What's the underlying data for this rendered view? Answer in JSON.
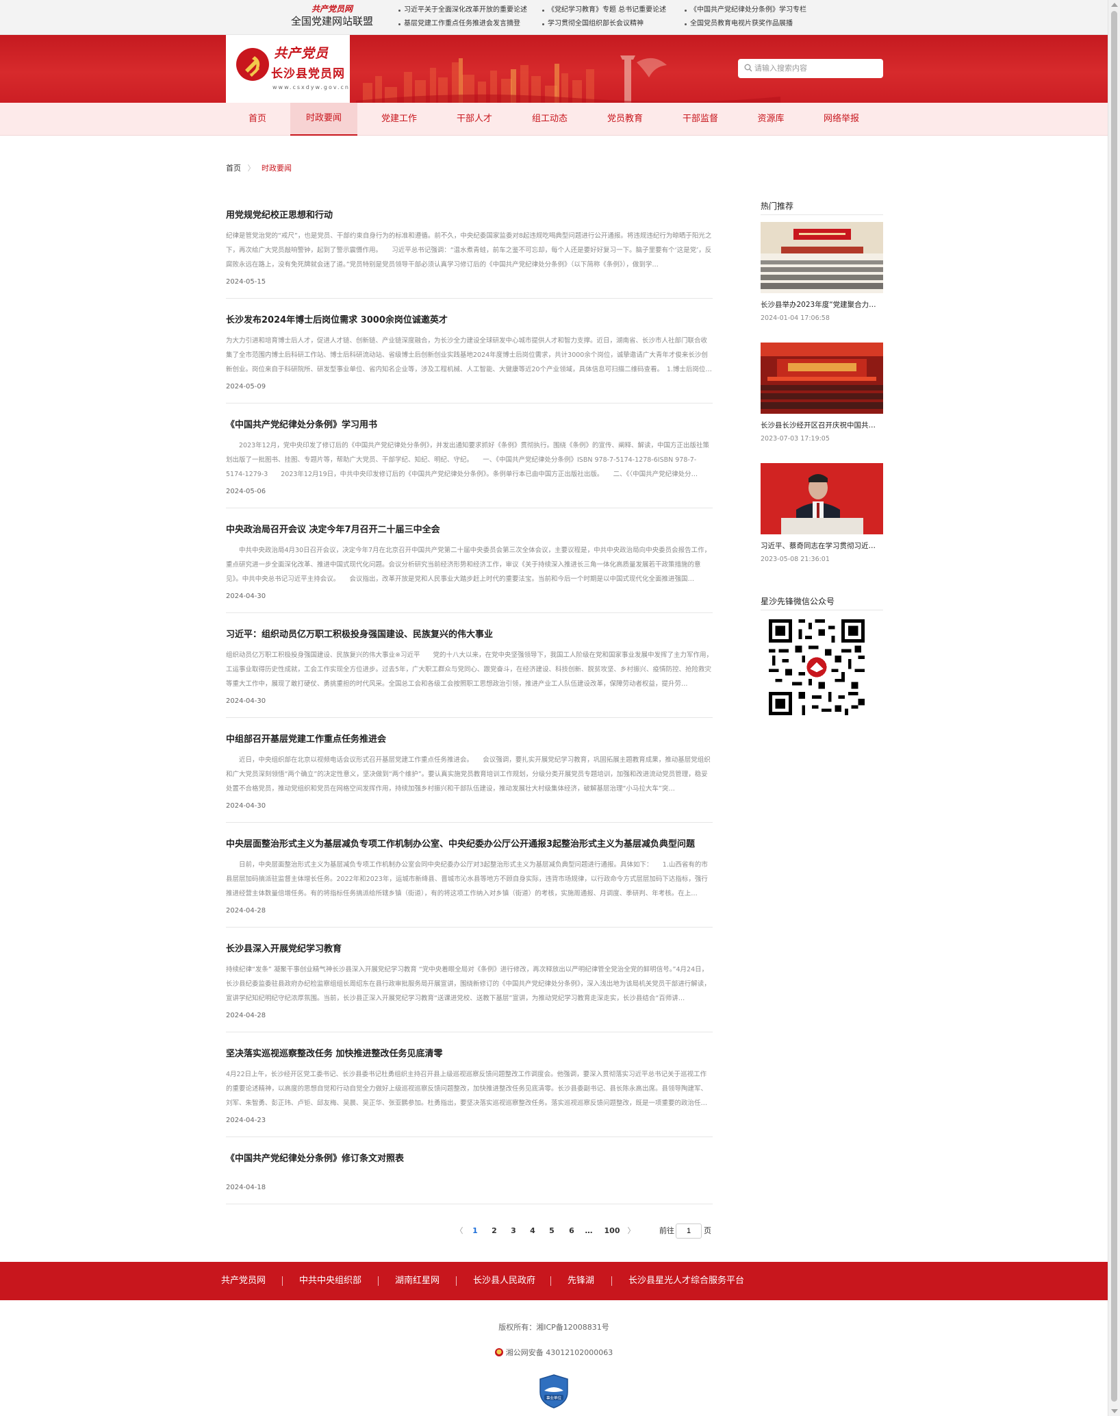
{
  "topbar": {
    "logo_calligraphy": "共产党员网",
    "alliance_title": "全国党建网站联盟",
    "links": [
      "习近平关于全面深化改革开放的重要论述",
      "《党纪学习教育》专题 总书记重要论述",
      "《中国共产党纪律处分条例》学习专栏",
      "基层党建工作重点任务推进会发言摘登",
      "学习贯彻全国组织部长会议精神",
      "全国党员教育电视片获奖作品展播"
    ]
  },
  "header": {
    "logo_calligraphy": "共产党员",
    "site_name": "长沙县党员网",
    "site_url": "www.csxdyw.gov.cn",
    "search_placeholder": "请输入搜索内容"
  },
  "nav": {
    "items": [
      "首页",
      "时政要闻",
      "党建工作",
      "干部人才",
      "组工动态",
      "党员教育",
      "干部监督",
      "资源库",
      "网络举报"
    ],
    "active_index": 1
  },
  "breadcrumb": {
    "home": "首页",
    "separator": "〉",
    "current": "时政要闻"
  },
  "articles": [
    {
      "title": "用党规党纪校正思想和行动",
      "summary": "纪律是管党治党的“戒尺”，也是党员、干部约束自身行为的标准和遵循。前不久，中央纪委国家监委对8起违规吃喝典型问题进行公开通报。将违规违纪行为晾晒于阳光之下，再次给广大党员敲响警钟，起到了警示震慑作用。　　习近平总书记强调：“温水煮青蛙，前车之鉴不可忘却，每个人还是要好好复习一下。脑子里要有个‘这是党’，反腐败永远在路上，没有免死牌就会迷了道。”党员特别是党员领导干部必须认真学习修订后的《中国共产党纪律处分条例》（以下简称《条例》），做到学…",
      "date": "2024-05-15"
    },
    {
      "title": "长沙发布2024年博士后岗位需求 3000余岗位诚邀英才",
      "summary": "为大力引进和培育博士后人才，促进人才链、创新链、产业链深度融合，为长沙全力建设全球研发中心城市提供人才和智力支撑。近日，湖南省、长沙市人社部门联合收集了全市范围内博士后科研工作站、博士后科研流动站、省级博士后创新创业实践基地2024年度博士后岗位需求，共计3000余个岗位，诚挚邀请广大青年才俊来长沙创新创业。岗位来自于科研院所、研发型事业单位、省内知名企业等，涉及工程机械、人工智能、大健康等近20个产业领域，具体信息可扫描二维码查看。　1.博士后岗位…",
      "date": "2024-05-09"
    },
    {
      "title": "《中国共产党纪律处分条例》学习用书",
      "summary": "　　2023年12月，党中央印发了修订后的《中国共产党纪律处分条例》，并发出通知要求抓好《条例》贯彻执行。围绕《条例》的宣传、阐释、解读，中国方正出版社策划出版了一批图书、挂图、专题片等，帮助广大党员、干部学纪、知纪、明纪、守纪。　　一、《中国共产党纪律处分条例》ISBN 978-7-5174-1278-6ISBN 978-7-5174-1279-3　　2023年12月19日，中共中央印发修订后的《中国共产党纪律处分条例》。条例单行本已由中国方正出版社出版。　　二、《〈中国共产党纪律处分…",
      "date": "2024-05-06"
    },
    {
      "title": "中央政治局召开会议 决定今年7月召开二十届三中全会",
      "summary": "　　中共中央政治局4月30日召开会议，决定今年7月在北京召开中国共产党第二十届中央委员会第三次全体会议，主要议程是，中共中央政治局向中央委员会报告工作，重点研究进一步全面深化改革、推进中国式现代化问题。会议分析研究当前经济形势和经济工作，审议《关于持续深入推进长三角一体化高质量发展若干政策措施的意见》。中共中央总书记习近平主持会议。　　会议指出，改革开放是党和人民事业大踏步赶上时代的重要法宝。当前和今后一个时期是以中国式现代化全面推进强国…",
      "date": "2024-04-30"
    },
    {
      "title": "习近平：组织动员亿万职工积极投身强国建设、民族复兴的伟大事业",
      "summary": "组织动员亿万职工积极投身强国建设、民族复兴的伟大事业※习近平　　党的十八大以来，在党中央坚强领导下，我国工人阶级在党和国家事业发展中发挥了主力军作用，工运事业取得历史性成就，工会工作实现全方位进步。过去5年，广大职工群众与党同心、跟党奋斗，在经济建设、科技创新、脱贫攻坚、乡村振兴、疫情防控、抢险救灾等重大工作中，展现了敢打硬仗、勇挑重担的时代风采。全国总工会和各级工会按照职工思想政治引领，推进产业工人队伍建设改革，保障劳动者权益，提升劳…",
      "date": "2024-04-30"
    },
    {
      "title": "中组部召开基层党建工作重点任务推进会",
      "summary": "　　近日，中央组织部在北京以视频电话会议形式召开基层党建工作重点任务推进会。　　会议强调，要扎实开展党纪学习教育，巩固拓展主题教育成果，推动基层党组织和广大党员深刻领悟“两个确立”的决定性意义，坚决做到“两个维护”。要认真实施党员教育培训工作规划，分级分类开展党员专题培训，加强和改进流动党员管理，稳妥处置不合格党员，推动党组织和党员在网格空间发挥作用，持续加强乡村振兴和干部队伍建设，推动发展壮大村级集体经济，破解基层治理“小马拉大车”突…",
      "date": "2024-04-30"
    },
    {
      "title": "中央层面整治形式主义为基层减负专项工作机制办公室、中央纪委办公厅公开通报3起整治形式主义为基层减负典型问题",
      "summary": "　　日前，中央层面整治形式主义为基层减负专项工作机制办公室会同中央纪委办公厅对3起整治形式主义为基层减负典型问题进行通报。具体如下：　　1.山西省有的市县层层加码搞派驻监督主体增长任务。2022年和2023年，运城市新绛县、晋城市沁水县等地方不顾自身实际，违背市场规律，以行政命令方式层层加码下达指标，强行推进经营主体数量倍增任务。有的将指标任务搞派给所辖乡镇（街道），有的将这项工作纳入对乡镇（街道）的考核，实施周通报、月调度、季研判、年考核。在上…",
      "date": "2024-04-28"
    },
    {
      "title": "长沙县深入开展党纪学习教育",
      "summary": "持续纪律“发条” 凝聚干事创业精气神长沙县深入开展党纪学习教育 “党中央着眼全局对《条例》进行修改，再次释放出以严明纪律管全党治全党的鲜明信号。”4月24日，长沙县纪委监委驻县政府办纪检监察组组长周绍东在县行政审批服务局开展宣讲，围绕新修订的《中国共产党纪律处分条例》，深入浅出地为该局机关党员干部进行解读，宣讲学纪知纪明纪守纪浓厚氛围。当前，长沙县正深入开展党纪学习教育“送课进党校、送教下基层”宣讲，为推动党纪学习教育走深走实，长沙县结合“百师讲…",
      "date": "2024-04-28"
    },
    {
      "title": "坚决落实巡视巡察整改任务 加快推进整改任务见底清零",
      "summary": "4月22日上午，长沙经开区党工委书记、长沙县委书记杜勇组织主持召开县上级巡视巡察反馈问题整改工作调度会。他强调，要深入贯彻落实习近平总书记关于巡视工作的重要论述精神，以高度的思想自觉和行动自觉全力做好上级巡视巡察反馈问题整改，加快推进整改任务见底清零。长沙县委副书记、县长陈永高出席。县领导陶建军、刘军、朱智勇、彭正玮、卢钜、邱友梅、吴晨、吴正华、张亚鹏参加。杜勇指出，要坚决落实巡视巡察整改任务。落实巡视巡察反馈问题整改，既是一项重要的政治任…",
      "date": "2024-04-23"
    },
    {
      "title": "《中国共产党纪律处分条例》修订条文对照表",
      "summary": "",
      "date": "2024-04-18"
    }
  ],
  "pagination": {
    "prev": "〈",
    "pages": [
      "1",
      "2",
      "3",
      "4",
      "5",
      "6"
    ],
    "ellipsis": "…",
    "last": "100",
    "next": "〉",
    "current": "1",
    "goto_label": "前往",
    "goto_value": "1",
    "unit": "页"
  },
  "sidebar": {
    "hot_heading": "热门推荐",
    "hot_items": [
      {
        "title": "长沙县举办2023年度“党建聚合力…",
        "date": "2024-01-04 17:06:58"
      },
      {
        "title": "长沙县长沙经开区召开庆祝中国共…",
        "date": "2023-07-03 17:19:05"
      },
      {
        "title": "习近平、蔡奇同志在学习贯彻习近…",
        "date": "2023-05-08 21:36:01"
      }
    ],
    "wechat_heading": "星沙先锋微信公众号"
  },
  "footer": {
    "links": [
      "共产党员网",
      "中共中央组织部",
      "湖南红星网",
      "长沙县人民政府",
      "先锋湖",
      "长沙县星光人才综合服务平台"
    ],
    "copyright": "版权所有：湘ICP备12008831号",
    "police": "湘公网安备 43012102000063",
    "badge_text": "事业单位"
  },
  "colors": {
    "brand_red": "#c8161d",
    "nav_bg": "#fdeaea",
    "link_blue": "#1e6fd9"
  }
}
